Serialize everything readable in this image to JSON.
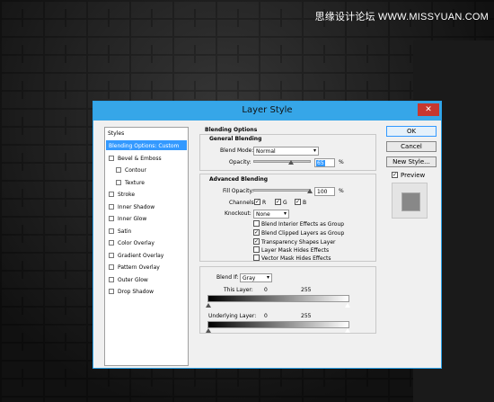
{
  "watermark": "思缘设计论坛 WWW.MISSYUAN.COM",
  "dialog": {
    "title": "Layer Style",
    "close_glyph": "✕"
  },
  "styles_list": {
    "header": "Styles",
    "items": [
      {
        "label": "Blending Options: Custom",
        "selected": true,
        "checkbox": false
      },
      {
        "label": "Bevel & Emboss",
        "checkbox": true
      },
      {
        "label": "Contour",
        "checkbox": true,
        "indent": true
      },
      {
        "label": "Texture",
        "checkbox": true,
        "indent": true
      },
      {
        "label": "Stroke",
        "checkbox": true
      },
      {
        "label": "Inner Shadow",
        "checkbox": true
      },
      {
        "label": "Inner Glow",
        "checkbox": true
      },
      {
        "label": "Satin",
        "checkbox": true
      },
      {
        "label": "Color Overlay",
        "checkbox": true
      },
      {
        "label": "Gradient Overlay",
        "checkbox": true
      },
      {
        "label": "Pattern Overlay",
        "checkbox": true
      },
      {
        "label": "Outer Glow",
        "checkbox": true
      },
      {
        "label": "Drop Shadow",
        "checkbox": true
      }
    ]
  },
  "blending": {
    "section_title": "Blending Options",
    "general_title": "General Blending",
    "blend_mode_label": "Blend Mode:",
    "blend_mode_value": "Normal",
    "opacity_label": "Opacity:",
    "opacity_value": "65",
    "percent": "%",
    "opacity_fraction": 0.65
  },
  "advanced": {
    "title": "Advanced Blending",
    "fill_opacity_label": "Fill Opacity:",
    "fill_opacity_value": "100",
    "percent": "%",
    "channels_label": "Channels:",
    "channels": [
      "R",
      "G",
      "B"
    ],
    "knockout_label": "Knockout:",
    "knockout_value": "None",
    "options": [
      {
        "label": "Blend Interior Effects as Group",
        "checked": false
      },
      {
        "label": "Blend Clipped Layers as Group",
        "checked": true
      },
      {
        "label": "Transparency Shapes Layer",
        "checked": true
      },
      {
        "label": "Layer Mask Hides Effects",
        "checked": false
      },
      {
        "label": "Vector Mask Hides Effects",
        "checked": false
      }
    ]
  },
  "blend_if": {
    "label": "Blend If:",
    "value": "Gray",
    "this_layer_label": "This Layer:",
    "underlying_label": "Underlying Layer:",
    "min": "0",
    "max": "255"
  },
  "buttons": {
    "ok": "OK",
    "cancel": "Cancel",
    "new_style": "New Style...",
    "preview_label": "Preview",
    "preview_checked": true
  },
  "checkmark": "✓",
  "chevron": "▾"
}
